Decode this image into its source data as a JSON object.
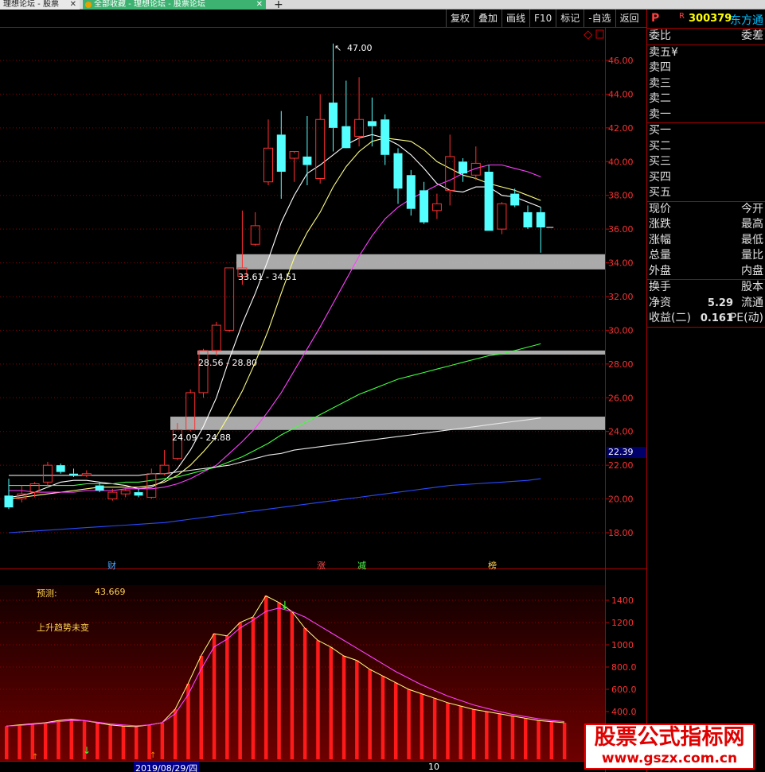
{
  "tabs": [
    {
      "label": "理想论坛 - 股票"
    },
    {
      "label": "全部收藏 - 理想论坛 - 股票论坛"
    }
  ],
  "toolbar": [
    "复权",
    "叠加",
    "画线",
    "F10",
    "标记",
    "-自选",
    "返回"
  ],
  "stock": {
    "p": "P",
    "r": "R",
    "code": "300379",
    "name": "东方通"
  },
  "panel": {
    "weibi": "委比",
    "weicha": "委差",
    "sell": [
      "卖五",
      "卖四",
      "卖三",
      "卖二",
      "卖一"
    ],
    "sell_unit": "¥",
    "buy": [
      "买一",
      "买二",
      "买三",
      "买四",
      "买五"
    ],
    "quote": [
      {
        "left": "现价",
        "right": "今开"
      },
      {
        "left": "涨跌",
        "right": "最高"
      },
      {
        "left": "涨幅",
        "right": "最低"
      },
      {
        "left": "总量",
        "right": "量比"
      },
      {
        "left": "外盘",
        "right": "内盘"
      }
    ],
    "fin": [
      {
        "left": "换手",
        "mid": "",
        "right": "股本"
      },
      {
        "left": "净资",
        "mid": "5.29",
        "right": "流通"
      },
      {
        "left": "收益(二)",
        "mid": "0.161",
        "right": "PE(动)"
      }
    ]
  },
  "price_axis": [
    "46.00",
    "44.00",
    "42.00",
    "40.00",
    "38.00",
    "36.00",
    "34.00",
    "32.00",
    "30.00",
    "28.00",
    "26.00",
    "24.00",
    "22.00",
    "20.00",
    "18.00"
  ],
  "current_price": "22.39",
  "high_label": "47.00",
  "zones": [
    {
      "label": "33.61 - 34.51"
    },
    {
      "label": "28.56 - 28.80"
    },
    {
      "label": "24.09 - 24.88"
    }
  ],
  "events": [
    {
      "text": "财",
      "color": "#4da6ff"
    },
    {
      "text": "涨",
      "color": "#ff4d4d"
    },
    {
      "text": "减",
      "color": "#4dff4d"
    },
    {
      "text": "榜",
      "color": "#ffd24d"
    }
  ],
  "indicator": {
    "forecast_label": "预测:",
    "forecast_value": "43.669",
    "trend_text": "上升趋势未变",
    "axis": [
      "1400",
      "1200",
      "1000",
      "800.0",
      "600.0",
      "400.0"
    ]
  },
  "date_marker": "2019/08/29/四",
  "month_marker": "10",
  "watermark": {
    "line1": "股票公式指标网",
    "line2": "www.gszx.com.cn"
  },
  "colors": {
    "up": "#ff3030",
    "down": "#54ffff",
    "ma5": "#ffffff",
    "ma10": "#ffff80",
    "ma20": "#ff40ff",
    "ma60": "#40ff40",
    "ma120": "#e8e8e8",
    "ma250": "#2a4bff"
  },
  "chart_data": {
    "type": "candlestick",
    "price_range": [
      16.5,
      48.0
    ],
    "candles": [
      {
        "o": 20.2,
        "h": 21.2,
        "l": 19.4,
        "c": 19.5
      },
      {
        "o": 20.0,
        "h": 20.8,
        "l": 19.8,
        "c": 20.3
      },
      {
        "o": 20.4,
        "h": 21.0,
        "l": 20.1,
        "c": 20.9
      },
      {
        "o": 21.0,
        "h": 22.2,
        "l": 20.8,
        "c": 22.0
      },
      {
        "o": 22.0,
        "h": 22.1,
        "l": 21.5,
        "c": 21.6
      },
      {
        "o": 21.5,
        "h": 21.8,
        "l": 21.3,
        "c": 21.4
      },
      {
        "o": 21.4,
        "h": 21.7,
        "l": 21.3,
        "c": 21.5
      },
      {
        "o": 20.8,
        "h": 21.0,
        "l": 20.4,
        "c": 20.5
      },
      {
        "o": 20.0,
        "h": 20.6,
        "l": 19.9,
        "c": 20.4
      },
      {
        "o": 20.3,
        "h": 20.7,
        "l": 20.1,
        "c": 20.5
      },
      {
        "o": 20.4,
        "h": 20.6,
        "l": 20.1,
        "c": 20.2
      },
      {
        "o": 20.1,
        "h": 21.8,
        "l": 20.0,
        "c": 21.5
      },
      {
        "o": 21.5,
        "h": 22.9,
        "l": 21.4,
        "c": 22.0
      },
      {
        "o": 22.4,
        "h": 24.5,
        "l": 22.3,
        "c": 24.1
      },
      {
        "o": 24.1,
        "h": 26.5,
        "l": 24.0,
        "c": 26.3
      },
      {
        "o": 26.3,
        "h": 28.9,
        "l": 26.0,
        "c": 28.8
      },
      {
        "o": 28.8,
        "h": 30.5,
        "l": 28.5,
        "c": 30.3
      },
      {
        "o": 30.0,
        "h": 33.7,
        "l": 29.9,
        "c": 33.7
      },
      {
        "o": 33.2,
        "h": 37.1,
        "l": 32.7,
        "c": 33.7
      },
      {
        "o": 35.1,
        "h": 37.0,
        "l": 35.0,
        "c": 36.2
      },
      {
        "o": 38.8,
        "h": 42.5,
        "l": 38.6,
        "c": 40.8
      },
      {
        "o": 41.6,
        "h": 43.0,
        "l": 37.8,
        "c": 39.4
      },
      {
        "o": 40.2,
        "h": 40.5,
        "l": 38.8,
        "c": 40.6
      },
      {
        "o": 40.3,
        "h": 42.7,
        "l": 38.6,
        "c": 39.8
      },
      {
        "o": 39.0,
        "h": 44.0,
        "l": 38.7,
        "c": 42.5
      },
      {
        "o": 43.5,
        "h": 47.0,
        "l": 40.6,
        "c": 42.0
      },
      {
        "o": 42.1,
        "h": 44.8,
        "l": 41.0,
        "c": 40.8
      },
      {
        "o": 41.5,
        "h": 45.0,
        "l": 40.9,
        "c": 42.5
      },
      {
        "o": 42.4,
        "h": 43.8,
        "l": 40.9,
        "c": 42.1
      },
      {
        "o": 42.5,
        "h": 42.8,
        "l": 39.8,
        "c": 40.4
      },
      {
        "o": 40.5,
        "h": 40.8,
        "l": 37.5,
        "c": 38.4
      },
      {
        "o": 39.2,
        "h": 39.5,
        "l": 36.8,
        "c": 37.2
      },
      {
        "o": 38.3,
        "h": 38.8,
        "l": 36.3,
        "c": 36.4
      },
      {
        "o": 37.1,
        "h": 38.1,
        "l": 36.6,
        "c": 37.5
      },
      {
        "o": 38.3,
        "h": 41.6,
        "l": 37.4,
        "c": 40.3
      },
      {
        "o": 40.0,
        "h": 40.2,
        "l": 38.8,
        "c": 39.3
      },
      {
        "o": 39.2,
        "h": 40.9,
        "l": 38.9,
        "c": 39.9
      },
      {
        "o": 39.4,
        "h": 39.8,
        "l": 35.9,
        "c": 35.9
      },
      {
        "o": 36.0,
        "h": 37.6,
        "l": 35.7,
        "c": 37.5
      },
      {
        "o": 38.1,
        "h": 38.4,
        "l": 37.3,
        "c": 37.4
      },
      {
        "o": 37.0,
        "h": 37.4,
        "l": 36.0,
        "c": 36.1
      },
      {
        "o": 37.0,
        "h": 37.3,
        "l": 34.6,
        "c": 36.1
      }
    ],
    "ma_lines": {
      "ma5": [
        20.1,
        20.2,
        20.4,
        20.7,
        21.0,
        21.1,
        21.1,
        21.0,
        20.9,
        20.8,
        20.6,
        20.7,
        21.1,
        21.8,
        22.9,
        24.3,
        26.0,
        28.3,
        30.4,
        32.2,
        34.2,
        36.4,
        38.0,
        39.3,
        39.8,
        40.4,
        41.0,
        41.4,
        41.6,
        41.4,
        41.0,
        40.4,
        39.6,
        38.7,
        38.3,
        38.2,
        38.5,
        38.5,
        38.0,
        37.9,
        37.6,
        37.3
      ],
      "ma10": [
        20.0,
        20.1,
        20.2,
        20.3,
        20.4,
        20.5,
        20.6,
        20.7,
        20.7,
        20.7,
        20.7,
        20.8,
        21.0,
        21.4,
        22.0,
        22.8,
        23.7,
        25.0,
        26.4,
        28.1,
        30.0,
        32.2,
        34.3,
        35.8,
        37.0,
        38.5,
        39.7,
        40.6,
        41.2,
        41.4,
        41.3,
        41.2,
        40.7,
        40.0,
        39.6,
        39.2,
        39.0,
        38.7,
        38.5,
        38.3,
        38.0,
        37.7
      ],
      "ma20": [
        20.5,
        20.5,
        20.4,
        20.4,
        20.4,
        20.4,
        20.5,
        20.5,
        20.5,
        20.6,
        20.6,
        20.6,
        20.7,
        20.9,
        21.2,
        21.6,
        22.0,
        22.7,
        23.4,
        24.2,
        25.2,
        26.3,
        27.6,
        28.9,
        30.2,
        31.6,
        33.0,
        34.4,
        35.6,
        36.6,
        37.3,
        37.8,
        38.2,
        38.6,
        38.9,
        39.3,
        39.6,
        39.8,
        39.8,
        39.6,
        39.4,
        39.1
      ],
      "ma60": [
        20.8,
        20.8,
        20.8,
        20.8,
        20.8,
        20.8,
        20.9,
        20.9,
        20.9,
        21.0,
        21.0,
        21.1,
        21.2,
        21.3,
        21.5,
        21.7,
        21.9,
        22.2,
        22.5,
        22.9,
        23.3,
        23.8,
        24.2,
        24.6,
        25.0,
        25.4,
        25.8,
        26.2,
        26.5,
        26.8,
        27.1,
        27.3,
        27.5,
        27.7,
        27.9,
        28.1,
        28.3,
        28.5,
        28.6,
        28.8,
        29.0,
        29.2
      ],
      "ma120": [
        21.4,
        21.4,
        21.4,
        21.4,
        21.4,
        21.4,
        21.4,
        21.4,
        21.4,
        21.4,
        21.4,
        21.5,
        21.5,
        21.6,
        21.7,
        21.8,
        21.9,
        22.0,
        22.2,
        22.4,
        22.6,
        22.7,
        22.9,
        23.0,
        23.1,
        23.2,
        23.3,
        23.4,
        23.5,
        23.6,
        23.7,
        23.8,
        23.9,
        24.0,
        24.1,
        24.2,
        24.3,
        24.4,
        24.5,
        24.6,
        24.7,
        24.8
      ],
      "ma250": [
        18.0,
        18.05,
        18.1,
        18.15,
        18.2,
        18.25,
        18.3,
        18.35,
        18.4,
        18.45,
        18.5,
        18.55,
        18.6,
        18.7,
        18.8,
        18.9,
        19.0,
        19.1,
        19.2,
        19.3,
        19.4,
        19.5,
        19.6,
        19.7,
        19.8,
        19.9,
        20.0,
        20.1,
        20.2,
        20.3,
        20.4,
        20.5,
        20.6,
        20.7,
        20.8,
        20.85,
        20.9,
        20.95,
        21.0,
        21.05,
        21.1,
        21.2
      ]
    },
    "zones": [
      [
        33.61,
        34.51
      ],
      [
        28.56,
        28.8
      ],
      [
        24.09,
        24.88
      ]
    ],
    "indicator_range": [
      250,
      1500
    ],
    "indicator_bars": [
      270,
      280,
      290,
      300,
      320,
      330,
      320,
      300,
      280,
      270,
      265,
      280,
      300,
      420,
      650,
      900,
      1100,
      1080,
      1200,
      1250,
      1440,
      1380,
      1300,
      1150,
      1040,
      980,
      900,
      860,
      780,
      720,
      660,
      600,
      560,
      520,
      480,
      450,
      420,
      400,
      380,
      360,
      340,
      320,
      310,
      300
    ],
    "indicator_line": [
      270,
      275,
      285,
      295,
      310,
      320,
      320,
      305,
      290,
      280,
      272,
      280,
      300,
      380,
      550,
      780,
      980,
      1050,
      1150,
      1220,
      1300,
      1330,
      1300,
      1250,
      1180,
      1110,
      1040,
      970,
      900,
      830,
      760,
      700,
      640,
      590,
      540,
      500,
      460,
      430,
      400,
      375,
      355,
      335,
      320,
      310
    ]
  }
}
